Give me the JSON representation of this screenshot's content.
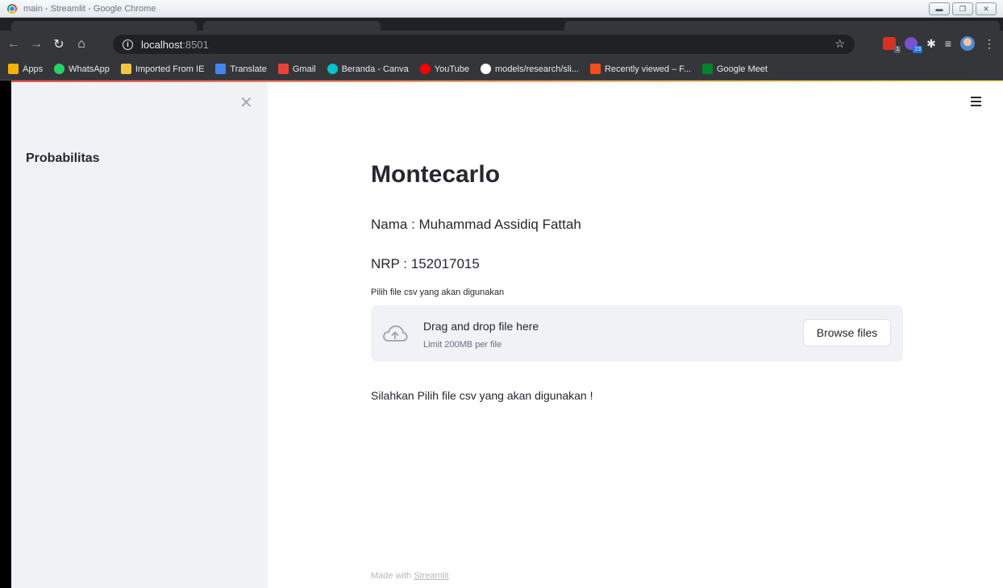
{
  "window": {
    "title": "main - Streamlit - Google Chrome"
  },
  "browser": {
    "url_host": "localhost",
    "url_port": ":8501"
  },
  "bookmarks": [
    {
      "label": "Apps",
      "color": "#f4b400"
    },
    {
      "label": "WhatsApp",
      "color": "#25d366"
    },
    {
      "label": "Imported From IE",
      "color": "#f4c542"
    },
    {
      "label": "Translate",
      "color": "#4285f4"
    },
    {
      "label": "Gmail",
      "color": "#ea4335"
    },
    {
      "label": "Beranda - Canva",
      "color": "#00c4cc"
    },
    {
      "label": "YouTube",
      "color": "#ff0000"
    },
    {
      "label": "models/research/sli...",
      "color": "#ffffff"
    },
    {
      "label": "Recently viewed – F...",
      "color": "#f24e1e"
    },
    {
      "label": "Google Meet",
      "color": "#00832d"
    }
  ],
  "extensions": {
    "badge_one": "1",
    "badge_two": "23"
  },
  "sidebar": {
    "title": "Probabilitas"
  },
  "main": {
    "title": "Montecarlo",
    "name_line": "Nama : Muhammad Assidiq Fattah",
    "nrp_line": "NRP : 152017015",
    "uploader_label": "Pilih file csv yang akan digunakan",
    "dropzone_text": "Drag and drop file here",
    "dropzone_limit": "Limit 200MB per file",
    "browse_label": "Browse files",
    "info_message": "Silahkan Pilih file csv yang akan digunakan !"
  },
  "footer": {
    "prefix": "Made with ",
    "link": "Streamlit"
  },
  "colors": {
    "sidebar_bg": "#f0f2f6",
    "text": "#262730",
    "accent": "#ff4b4b"
  }
}
